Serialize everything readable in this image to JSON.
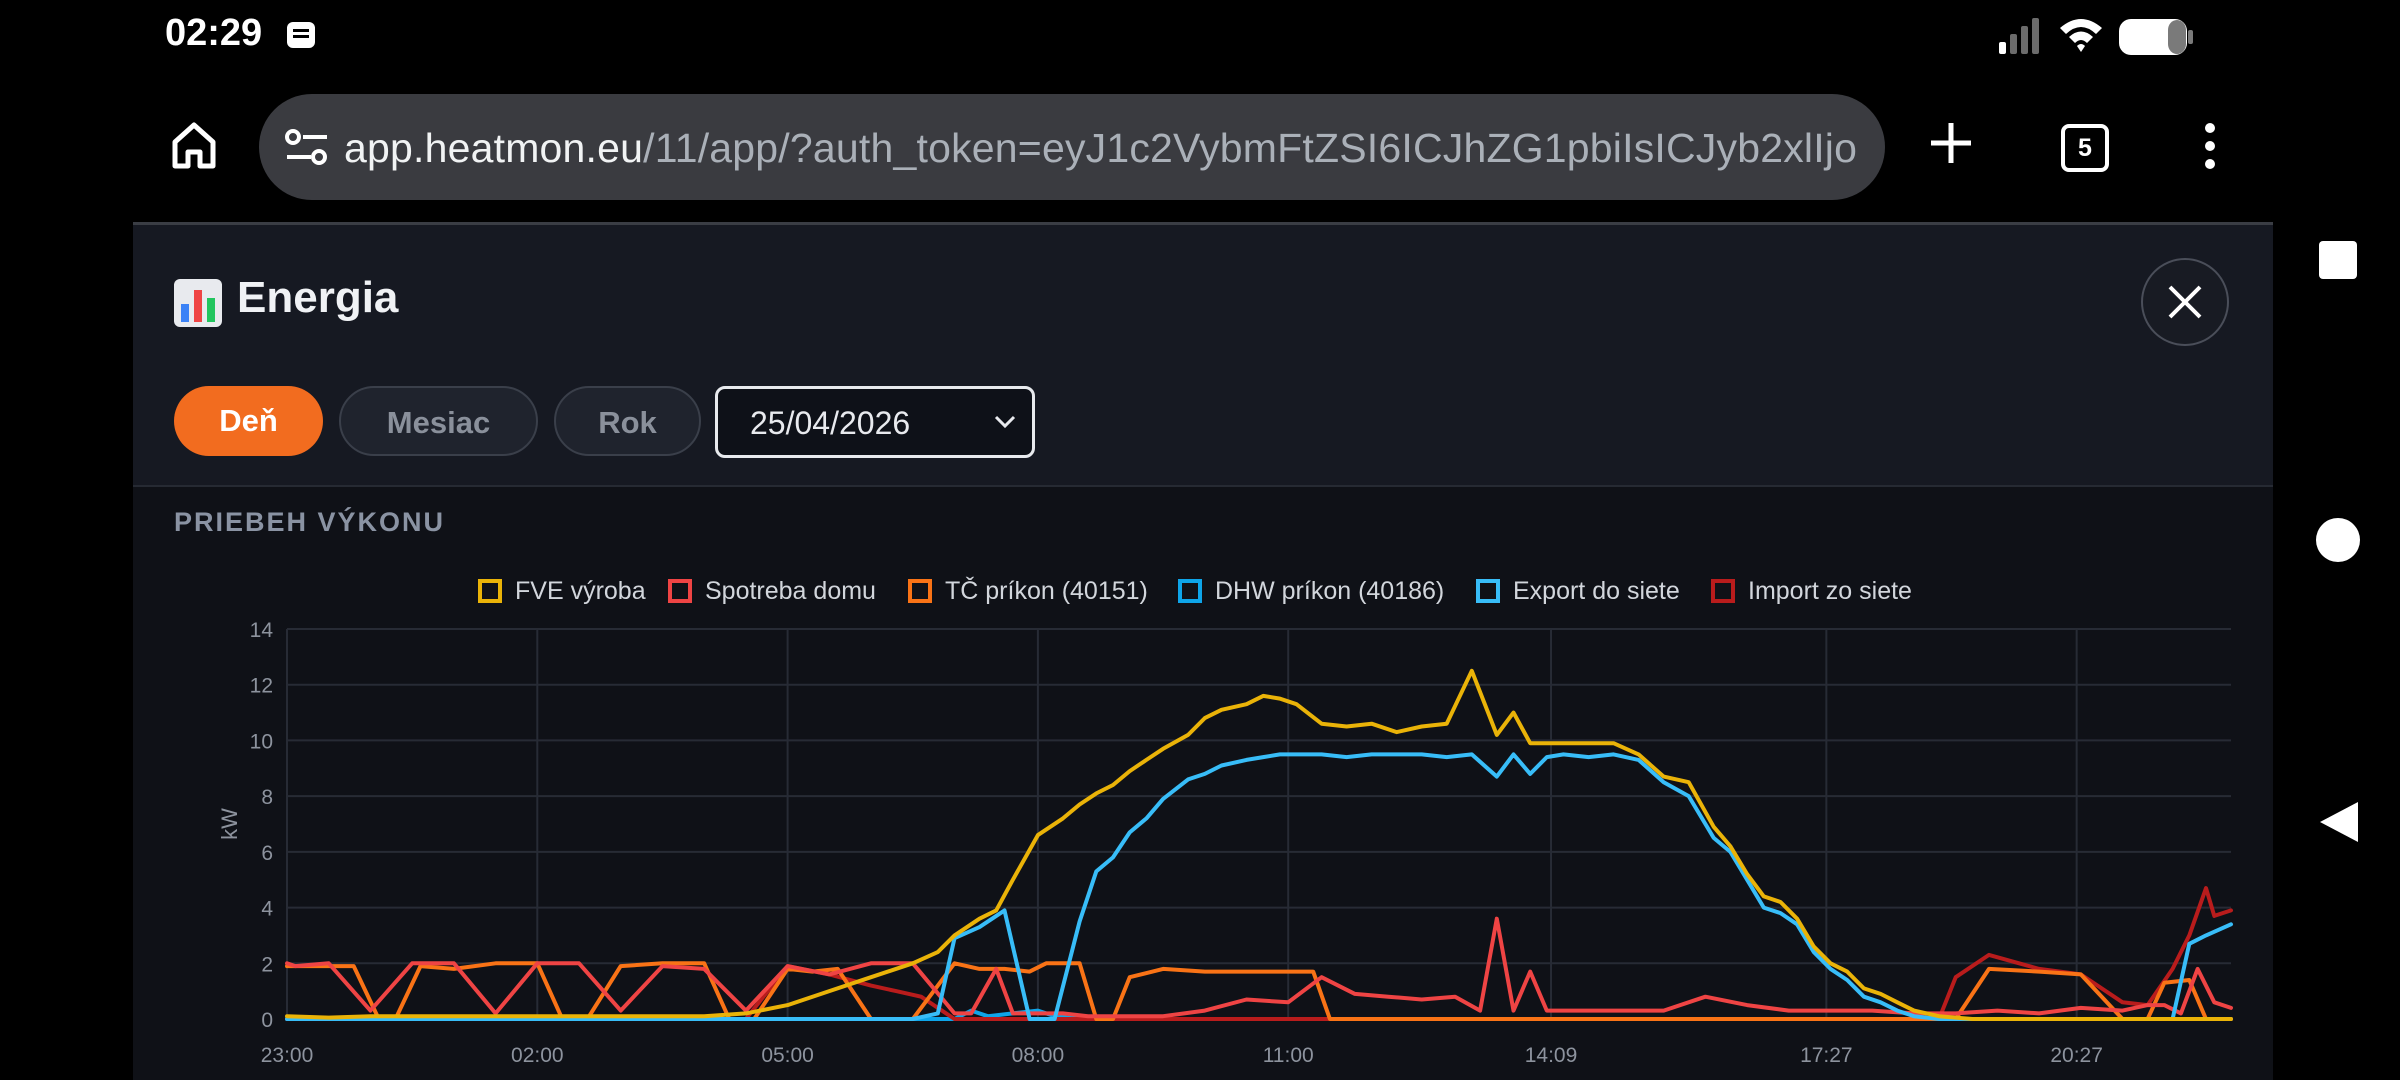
{
  "status_bar": {
    "time": "02:29"
  },
  "browser": {
    "url_domain": "app.heatmon.eu",
    "url_path": "/11/app/?auth_token=eyJ1c2VybmFtZSI6ICJhZG1pbiIsICJyb2xlIjo",
    "tab_count": "5"
  },
  "header": {
    "title": "Energia"
  },
  "range_tabs": [
    {
      "label": "Deň",
      "active": true
    },
    {
      "label": "Mesiac",
      "active": false
    },
    {
      "label": "Rok",
      "active": false
    }
  ],
  "date_picker": {
    "value": "25/04/2026"
  },
  "section": {
    "title": "PRIEBEH VÝKONU"
  },
  "colors": {
    "accent": "#f26c1f",
    "fve": "#eab308",
    "spotreba": "#ef4444",
    "tc": "#f97316",
    "dhw": "#0ea5e9",
    "export": "#38bdf8",
    "import": "#b91c1c"
  },
  "chart_data": {
    "type": "line",
    "ylabel": "kW",
    "ylim": [
      0,
      14
    ],
    "y_ticks": [
      "0",
      "2",
      "4",
      "6",
      "8",
      "10",
      "12",
      "14"
    ],
    "x_ticks": [
      "23:00",
      "02:00",
      "05:00",
      "08:00",
      "11:00",
      "14:09",
      "17:27",
      "20:27"
    ],
    "x_start_hours": 23.0,
    "x_end_hours": 46.3,
    "grid": true,
    "legend_position": "top",
    "series": [
      {
        "name": "FVE výroba",
        "color": "#eab308",
        "x": [
          23.0,
          23.5,
          24.0,
          25.0,
          26.0,
          27.0,
          28.0,
          28.5,
          29.0,
          29.5,
          30.0,
          30.5,
          30.8,
          31.0,
          31.3,
          31.5,
          31.7,
          32.0,
          32.3,
          32.5,
          32.7,
          32.9,
          33.1,
          33.3,
          33.5,
          33.8,
          34.0,
          34.2,
          34.5,
          34.7,
          34.9,
          35.1,
          35.4,
          35.7,
          36.0,
          36.3,
          36.6,
          36.9,
          37.2,
          37.5,
          37.7,
          37.9,
          38.1,
          38.3,
          38.6,
          38.9,
          39.2,
          39.5,
          39.8,
          40.1,
          40.3,
          40.5,
          40.7,
          40.9,
          41.1,
          41.3,
          41.5,
          41.7,
          41.9,
          42.1,
          42.3,
          42.5,
          42.8,
          43.2,
          44.0,
          45.0,
          46.3
        ],
        "y": [
          0.1,
          0.05,
          0.1,
          0.1,
          0.1,
          0.1,
          0.1,
          0.2,
          0.5,
          1.0,
          1.5,
          2.0,
          2.4,
          3.0,
          3.6,
          3.9,
          5.0,
          6.6,
          7.2,
          7.7,
          8.1,
          8.4,
          8.9,
          9.3,
          9.7,
          10.2,
          10.8,
          11.1,
          11.3,
          11.6,
          11.5,
          11.3,
          10.6,
          10.5,
          10.6,
          10.3,
          10.5,
          10.6,
          12.5,
          10.2,
          11.0,
          9.9,
          9.9,
          9.9,
          9.9,
          9.9,
          9.5,
          8.7,
          8.5,
          6.9,
          6.2,
          5.2,
          4.4,
          4.2,
          3.6,
          2.6,
          2.0,
          1.7,
          1.1,
          0.9,
          0.6,
          0.3,
          0.1,
          0.0,
          0.0,
          0.0,
          0.0
        ]
      },
      {
        "name": "Spotreba domu",
        "color": "#ef4444",
        "x": [
          23.0,
          23.1,
          23.5,
          24.0,
          24.5,
          25.0,
          25.5,
          26.0,
          26.5,
          27.0,
          27.5,
          28.0,
          28.5,
          29.0,
          29.5,
          30.0,
          30.5,
          31.0,
          31.2,
          31.5,
          31.7,
          32.0,
          32.3,
          32.6,
          33.0,
          33.5,
          34.0,
          34.5,
          35.0,
          35.4,
          35.8,
          36.2,
          36.6,
          37.0,
          37.3,
          37.5,
          37.7,
          37.9,
          38.1,
          38.3,
          38.5,
          39.0,
          39.5,
          40.0,
          40.5,
          41.0,
          41.5,
          42.0,
          42.5,
          43.0,
          43.5,
          44.0,
          44.5,
          45.0,
          45.3,
          45.5,
          45.7,
          45.9,
          46.1,
          46.3
        ],
        "y": [
          2.0,
          1.9,
          2.0,
          0.3,
          2.0,
          2.0,
          0.2,
          2.0,
          2.0,
          0.3,
          1.9,
          1.8,
          0.3,
          1.9,
          1.6,
          2.0,
          2.0,
          0.2,
          0.2,
          1.8,
          0.2,
          0.2,
          0.2,
          0.1,
          0.1,
          0.1,
          0.3,
          0.7,
          0.6,
          1.5,
          0.9,
          0.8,
          0.7,
          0.8,
          0.3,
          3.6,
          0.3,
          1.7,
          0.3,
          0.3,
          0.3,
          0.3,
          0.3,
          0.8,
          0.5,
          0.3,
          0.3,
          0.3,
          0.2,
          0.2,
          0.3,
          0.2,
          0.4,
          0.3,
          0.5,
          0.5,
          0.2,
          1.8,
          0.6,
          0.4
        ]
      },
      {
        "name": "TČ príkon (40151)",
        "color": "#f97316",
        "x": [
          23.0,
          23.5,
          23.8,
          24.1,
          24.3,
          24.6,
          25.0,
          25.5,
          26.0,
          26.3,
          26.6,
          27.0,
          27.5,
          28.0,
          28.3,
          28.6,
          29.0,
          29.3,
          29.6,
          30.0,
          30.5,
          31.0,
          31.3,
          31.6,
          31.9,
          32.1,
          32.3,
          32.5,
          32.7,
          32.9,
          33.1,
          33.5,
          34.0,
          34.5,
          35.0,
          35.3,
          35.5,
          36.0,
          37.0,
          38.0,
          39.0,
          40.0,
          41.0,
          42.0,
          42.7,
          43.0,
          43.4,
          44.0,
          44.5,
          45.0,
          45.3,
          45.5,
          45.8,
          46.0,
          46.3
        ],
        "y": [
          1.9,
          1.9,
          1.9,
          0.0,
          0.0,
          1.9,
          1.8,
          2.0,
          2.0,
          0.0,
          0.0,
          1.9,
          2.0,
          2.0,
          0.0,
          0.0,
          1.8,
          1.7,
          1.8,
          0.0,
          0.0,
          2.0,
          1.8,
          1.8,
          1.7,
          2.0,
          2.0,
          2.0,
          0.0,
          0.0,
          1.5,
          1.8,
          1.7,
          1.7,
          1.7,
          1.7,
          0.0,
          0.0,
          0.0,
          0.0,
          0.0,
          0.0,
          0.0,
          0.0,
          0.0,
          0.0,
          1.8,
          1.7,
          1.6,
          0.0,
          0.0,
          1.3,
          1.4,
          0.0,
          0.0
        ]
      },
      {
        "name": "DHW príkon (40186)",
        "color": "#0ea5e9",
        "x": [
          23.0,
          31.0,
          31.2,
          31.4,
          31.7,
          32.0,
          32.2,
          32.5,
          46.3
        ],
        "y": [
          0.0,
          0.0,
          0.3,
          0.1,
          0.2,
          0.3,
          0.1,
          0.0,
          0.0
        ]
      },
      {
        "name": "Export do siete",
        "color": "#38bdf8",
        "x": [
          23.0,
          30.5,
          30.8,
          31.0,
          31.3,
          31.6,
          31.9,
          32.0,
          32.2,
          32.5,
          32.7,
          32.9,
          33.1,
          33.3,
          33.5,
          33.8,
          34.0,
          34.2,
          34.5,
          34.7,
          34.9,
          35.1,
          35.4,
          35.7,
          36.0,
          36.3,
          36.6,
          36.9,
          37.2,
          37.5,
          37.7,
          37.9,
          38.1,
          38.3,
          38.6,
          38.9,
          39.2,
          39.5,
          39.8,
          40.1,
          40.3,
          40.5,
          40.7,
          40.9,
          41.1,
          41.3,
          41.5,
          41.7,
          41.9,
          42.1,
          42.3,
          42.5,
          42.8,
          43.2,
          44.0,
          45.0,
          45.6,
          45.8,
          46.0,
          46.3
        ],
        "y": [
          0.0,
          0.0,
          0.2,
          2.9,
          3.3,
          3.9,
          0.0,
          0.0,
          0.0,
          3.5,
          5.3,
          5.8,
          6.7,
          7.2,
          7.9,
          8.6,
          8.8,
          9.1,
          9.3,
          9.4,
          9.5,
          9.5,
          9.5,
          9.4,
          9.5,
          9.5,
          9.5,
          9.4,
          9.5,
          8.7,
          9.5,
          8.8,
          9.4,
          9.5,
          9.4,
          9.5,
          9.3,
          8.5,
          8.0,
          6.5,
          6.0,
          5.0,
          4.0,
          3.8,
          3.4,
          2.4,
          1.8,
          1.4,
          0.8,
          0.6,
          0.3,
          0.1,
          0.0,
          0.0,
          0.0,
          0.0,
          0.0,
          2.7,
          3.0,
          3.4
        ]
      },
      {
        "name": "Import zo siete",
        "color": "#b91c1c",
        "x": [
          23.0,
          28.5,
          29.0,
          29.5,
          30.0,
          30.3,
          30.6,
          31.0,
          42.8,
          43.0,
          43.4,
          44.0,
          44.5,
          45.0,
          45.3,
          45.6,
          45.8,
          46.0,
          46.1,
          46.3
        ],
        "y": [
          0.0,
          0.0,
          1.9,
          1.6,
          1.2,
          1.0,
          0.8,
          0.0,
          0.0,
          1.5,
          2.3,
          1.8,
          1.6,
          0.6,
          0.5,
          1.8,
          3.0,
          4.7,
          3.7,
          3.9
        ]
      }
    ]
  }
}
